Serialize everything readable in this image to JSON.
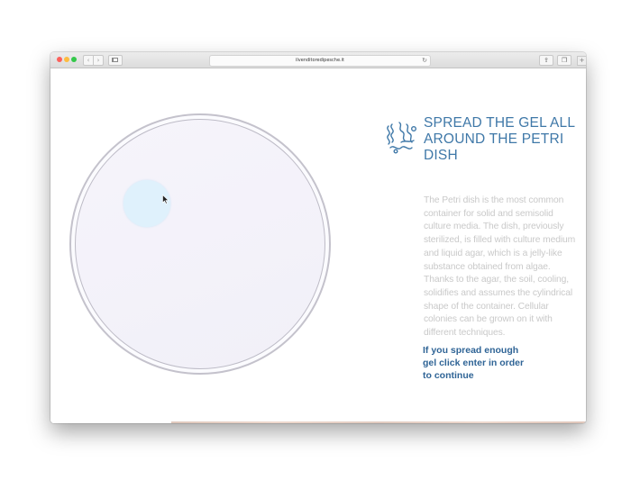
{
  "browser": {
    "url": "ilvenditoredipesche.it",
    "back_icon": "chevron-left-icon",
    "forward_icon": "chevron-right-icon",
    "reload_icon": "reload-icon",
    "share_icon": "share-icon",
    "tabs_icon": "tabs-icon",
    "newtab_icon": "plus-icon"
  },
  "content": {
    "headline": "SPREAD THE GEL ALL AROUND THE PETRI DISH",
    "description": "The Petri dish is the most common container for solid and semisolid culture media. The dish, previously sterilized, is filled with culture medium and liquid agar, which is a jelly-like substance obtained from algae. Thanks to the agar, the soil, cooling, solidifies and assumes the cylindrical shape of the container. Cellular colonies can be grown on it with different techniques.",
    "instruction": "If you spread enough gel click enter in order to continue"
  },
  "colors": {
    "accent": "#3f78a8",
    "instruction": "#2f6496",
    "body_text": "#c9c9c9",
    "gel": "#dff1fc",
    "dish_border": "#c4c2cc"
  }
}
